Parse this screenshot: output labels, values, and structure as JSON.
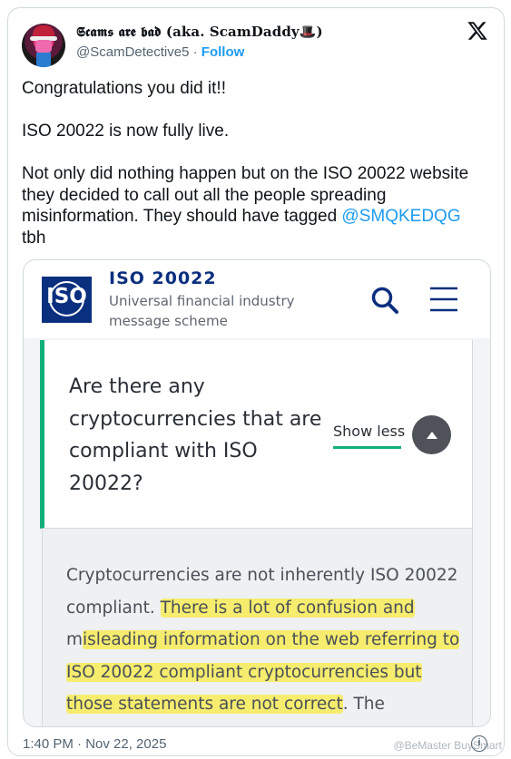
{
  "author": {
    "display_name": "𝕾𝖈𝖆𝖒𝖘 𝖆𝖗𝖊 𝖇𝖆𝖉 (aka. ScamDaddy🎩)",
    "handle": "@ScamDetective5",
    "separator": " · ",
    "follow_label": "Follow"
  },
  "tweet": {
    "text_before_mention": "Congratulations you did it!!\n\nISO 20022 is now fully live.\n\nNot only did nothing happen but on the ISO 20022 website they decided to call out all the people spreading misinformation. They should have tagged ",
    "mention": "@SMQKEDQG",
    "text_after_mention": "\ntbh"
  },
  "media": {
    "logo_text": "ISO",
    "site_title": "ISO 20022",
    "site_subtitle": "Universal financial industry message scheme",
    "faq_question": "Are there any cryptocurrencies that are compliant with ISO 20022?",
    "show_less_label": "Show less",
    "answer_plain_1": "Cryptocurrencies are not inherently ISO 20022 compliant. ",
    "answer_highlight_1": "There is a lot of confusion and",
    "answer_plain_2": " m",
    "answer_highlight_2": "isleading information on the web referring to ISO 20022 compliant cryptocurrencies but those statements are not correct",
    "answer_plain_3": ". The",
    "highlight_color": "#f6ec6e",
    "accent_color": "#11b07a",
    "brand_color": "#0b2f7f"
  },
  "footer": {
    "timestamp": "1:40 PM · Nov 22, 2025",
    "watermark": "@BeMaster BuySmart"
  },
  "icons": {
    "x_logo": "x-logo-icon",
    "search": "search-icon",
    "menu": "hamburger-menu-icon",
    "collapse": "chevron-up-icon",
    "info": "info-icon"
  }
}
